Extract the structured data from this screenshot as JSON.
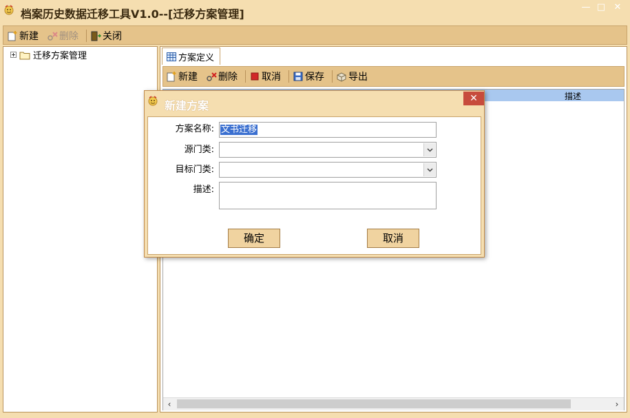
{
  "window": {
    "title": "档案历史数据迁移工具V1.0--[迁移方案管理]",
    "minimize": "—",
    "maximize": "□",
    "close": "✕"
  },
  "toolbar": {
    "new_label": "新建",
    "delete_label": "删除",
    "close_label": "关闭"
  },
  "tree": {
    "root_label": "迁移方案管理"
  },
  "tabs": [
    {
      "label": "方案定义",
      "active": true
    }
  ],
  "sub_toolbar": {
    "new_label": "新建",
    "delete_label": "删除",
    "cancel_label": "取消",
    "save_label": "保存",
    "export_label": "导出"
  },
  "grid": {
    "columns": [
      "描述"
    ],
    "scroll_left": "‹",
    "scroll_right": "›"
  },
  "dialog": {
    "title": "新建方案",
    "close": "✕",
    "fields": {
      "name_label": "方案名称:",
      "name_value": "文书迁移",
      "source_label": "源门类:",
      "source_value": "",
      "target_label": "目标门类:",
      "target_value": "",
      "desc_label": "描述:",
      "desc_value": ""
    },
    "ok_label": "确定",
    "cancel_label": "取消"
  },
  "colors": {
    "chrome": "#f5deb0",
    "toolbar": "#e5c38a",
    "grid_header": "#a9c8ef",
    "close_red": "#c74b3c"
  }
}
